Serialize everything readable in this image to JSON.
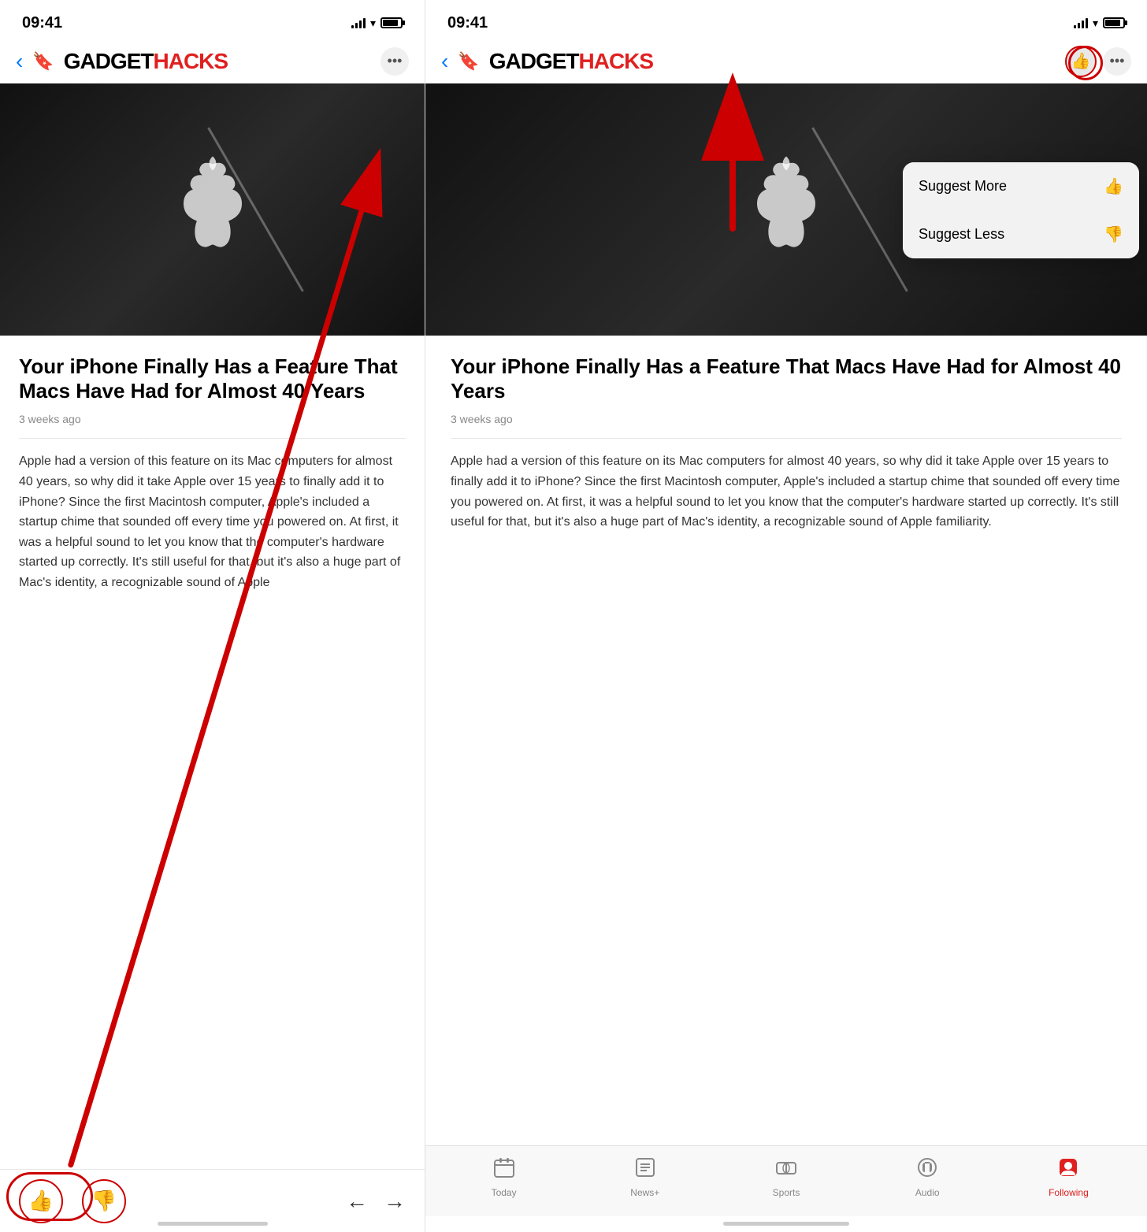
{
  "left_phone": {
    "status_time": "09:41",
    "nav": {
      "back_icon": "‹",
      "bookmark_icon": "🔖",
      "logo_gadget": "GADGET",
      "logo_hacks": "HACKS",
      "more_icon": "•••"
    },
    "article": {
      "title": "Your iPhone Finally Has a Feature That Macs Have Had for Almost 40 Years",
      "date": "3 weeks ago",
      "body": "Apple had a version of this feature on its Mac computers for almost 40 years, so why did it take Apple over 15 years to finally add it to iPhone? Since the first Macintosh computer, Apple's included a startup chime that sounded off every time you powered on. At first, it was a helpful sound to let you know that the computer's hardware started up correctly. It's still useful for that, but it's also a huge part of Mac's identity, a recognizable sound of Apple"
    },
    "bottom_bar": {
      "thumbs_up": "👍",
      "thumbs_down": "👎",
      "back_arrow": "←",
      "forward_arrow": "→"
    }
  },
  "right_phone": {
    "status_time": "09:41",
    "nav": {
      "back_icon": "‹",
      "bookmark_icon": "🔖",
      "logo_gadget": "GADGET",
      "logo_hacks": "HACKS",
      "thumb_icon": "👍",
      "more_icon": "•••"
    },
    "dropdown": {
      "suggest_more": "Suggest More",
      "suggest_more_icon": "👍",
      "suggest_less": "Suggest Less",
      "suggest_less_icon": "👎"
    },
    "article": {
      "title": "Your iPhone Finally Has a Feature That Macs Have Had for Almost 40 Years",
      "date": "3 weeks ago",
      "body": "Apple had a version of this feature on its Mac computers for almost 40 years, so why did it take Apple over 15 years to finally add it to iPhone? Since the first Macintosh computer, Apple's included a startup chime that sounded off every time you powered on. At first, it was a helpful sound to let you know that the computer's hardware started up correctly. It's still useful for that, but it's also a huge part of Mac's identity, a recognizable sound of Apple familiarity."
    },
    "tabs": [
      {
        "label": "Today",
        "icon": "📰",
        "active": false
      },
      {
        "label": "News+",
        "icon": "📄",
        "active": false
      },
      {
        "label": "Sports",
        "icon": "🏟",
        "active": false
      },
      {
        "label": "Audio",
        "icon": "🎧",
        "active": false
      },
      {
        "label": "Following",
        "icon": "🔍",
        "active": true
      }
    ]
  }
}
